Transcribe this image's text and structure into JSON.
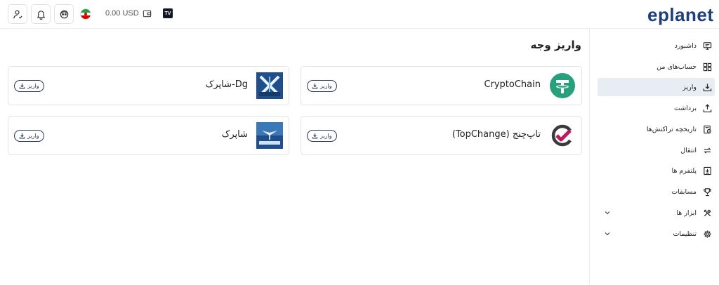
{
  "topbar": {
    "balance": "0.00 USD",
    "tv_badge": "TV",
    "logo_text": "eplanet",
    "icons": [
      "user-icon",
      "bell-icon",
      "support-avatar-icon",
      "iran-flag-icon",
      "wallet-icon",
      "tradingview-icon"
    ]
  },
  "sidebar": {
    "items": [
      {
        "label": "داشبورد",
        "icon": "dashboard-icon",
        "active": false
      },
      {
        "label": "حساب‌های من",
        "icon": "accounts-grid-icon",
        "active": false
      },
      {
        "label": "واریز",
        "icon": "deposit-icon",
        "active": true
      },
      {
        "label": "برداشت",
        "icon": "withdraw-icon",
        "active": false
      },
      {
        "label": "تاریخچه تراکنش‌ها",
        "icon": "history-icon",
        "active": false
      },
      {
        "label": "انتقال",
        "icon": "transfer-icon",
        "active": false
      },
      {
        "label": "پلتفرم ها",
        "icon": "platform-icon",
        "active": false
      },
      {
        "label": "مسابقات",
        "icon": "trophy-icon",
        "active": false
      },
      {
        "label": "ابزار ها",
        "icon": "tools-icon",
        "active": false,
        "expandable": true
      },
      {
        "label": "تنظیمات",
        "icon": "settings-icon",
        "active": false,
        "expandable": true
      }
    ]
  },
  "main": {
    "title": "واریز وجه",
    "cards": [
      {
        "name": "CryptoChain",
        "button": "واریز",
        "logo": "tether-logo"
      },
      {
        "name": "Dg-شاپرک",
        "button": "واریز",
        "logo": "shaparak-logo"
      },
      {
        "name": "تاپ‌چنج (TopChange)",
        "button": "واریز",
        "logo": "topchange-logo"
      },
      {
        "name": "شاپرک",
        "button": "واریز",
        "logo": "shaparak-logo"
      }
    ]
  },
  "colors": {
    "brand": "#1d3f7a",
    "active_bg": "#e8ecf3",
    "tether": "#26a17b",
    "topchange": "#c2185b"
  }
}
